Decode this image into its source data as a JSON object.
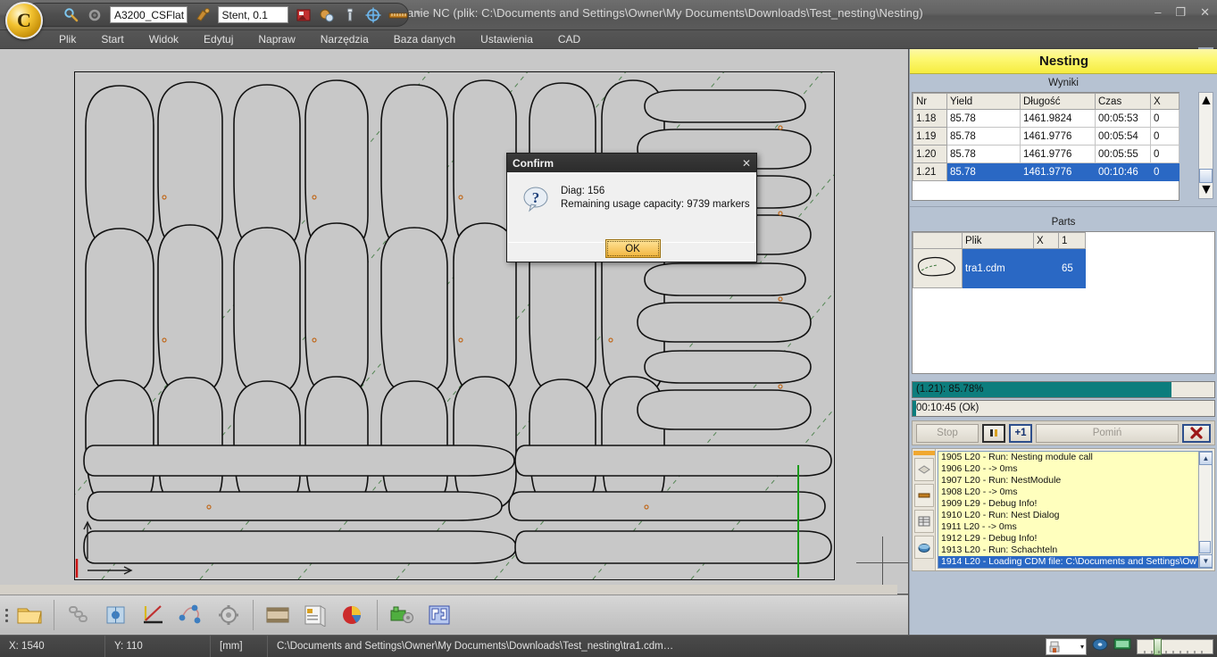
{
  "window": {
    "title": "CAGILA - Programowanie NC (plik: C:\\Documents and Settings\\Owner\\My Documents\\Downloads\\Test_nesting\\Nesting)",
    "minimize": "–",
    "maximize": "❐",
    "close": "✕",
    "orb_letter": "C"
  },
  "toolbar": {
    "icons": [
      "magnifier-icon",
      "gear-small-icon",
      "paint-icon",
      "image-icon",
      "camera-icon",
      "wrench-icon",
      "target-icon",
      "ruler-icon"
    ],
    "field1_value": "A3200_CSFlat",
    "field2_value": "Stent, 0.1",
    "overflow_chevron": "▾"
  },
  "menu": {
    "items": [
      "Plik",
      "Start",
      "Widok",
      "Edytuj",
      "Napraw",
      "Narzędzia",
      "Baza danych",
      "Ustawienia",
      "CAD"
    ]
  },
  "bottom_toolbar": {
    "buttons": [
      {
        "name": "open-folder-icon",
        "glyph": "📁"
      },
      {
        "name": "chain-icon",
        "glyph": "⛓"
      },
      {
        "name": "3d-cube-icon",
        "glyph": "▣"
      },
      {
        "name": "bend-angle-icon",
        "glyph": "∠"
      },
      {
        "name": "nodes-icon",
        "glyph": "⚭"
      },
      {
        "name": "gear-icon",
        "glyph": "⚙"
      },
      {
        "name": "film-icon",
        "glyph": "▤"
      },
      {
        "name": "report-icon",
        "glyph": "▥"
      },
      {
        "name": "pie-chart-icon",
        "glyph": "◕"
      },
      {
        "name": "machine-icon",
        "glyph": "❖"
      },
      {
        "name": "nesting-icon",
        "glyph": "⬚"
      }
    ]
  },
  "canvas": {
    "origin_marker": "origin-axes",
    "crosshair": "crosshair-cursor",
    "scroll_up": "▲",
    "scroll_down": "▼",
    "scroll_left": "◄",
    "scroll_right": "►"
  },
  "nesting_panel": {
    "header": "Nesting",
    "results_label": "Wyniki",
    "results_columns": [
      "Nr",
      "Yield",
      "Długość",
      "Czas",
      "X"
    ],
    "results_rows": [
      {
        "nr": "1.18",
        "yield": "85.78",
        "length": "1461.9824",
        "time": "00:05:53",
        "x": "0",
        "selected": false
      },
      {
        "nr": "1.19",
        "yield": "85.78",
        "length": "1461.9776",
        "time": "00:05:54",
        "x": "0",
        "selected": false
      },
      {
        "nr": "1.20",
        "yield": "85.78",
        "length": "1461.9776",
        "time": "00:05:55",
        "x": "0",
        "selected": false
      },
      {
        "nr": "1.21",
        "yield": "85.78",
        "length": "1461.9776",
        "time": "00:10:46",
        "x": "0",
        "selected": true
      }
    ],
    "parts_label": "Parts",
    "parts_columns": [
      "",
      "Plik",
      "X",
      "1"
    ],
    "parts_rows": [
      {
        "thumb": "part-thumbnail",
        "file": "tra1.cdm",
        "x": "",
        "qty": "65",
        "selected": true
      }
    ],
    "progress_main": {
      "text": "(1.21): 85.78%",
      "percent": 85.78
    },
    "progress_time": {
      "text": "00:10:45 (Ok)",
      "percent": 1
    },
    "controls": {
      "stop_label": "Stop",
      "pause_label": "❙❙",
      "plus_one_label": "+1",
      "skip_label": "Pomiń",
      "cancel_label": "✕"
    },
    "log_lines": [
      {
        "text": "1905 L20 - Run: Nesting module call",
        "selected": false
      },
      {
        "text": "1906 L20 -  -> 0ms",
        "selected": false
      },
      {
        "text": "1907 L20 - Run: NestModule",
        "selected": false
      },
      {
        "text": "1908 L20 -  -> 0ms",
        "selected": false
      },
      {
        "text": "1909 L29 - Debug Info!",
        "selected": false
      },
      {
        "text": "1910 L20 - Run: Nest Dialog",
        "selected": false
      },
      {
        "text": "1911 L20 -  -> 0ms",
        "selected": false
      },
      {
        "text": "1912 L29 - Debug Info!",
        "selected": false
      },
      {
        "text": "1913 L20 - Run: Schachteln",
        "selected": false
      },
      {
        "text": "1914 L20 - Loading CDM file: C:\\Documents and Settings\\Ow",
        "selected": true
      }
    ],
    "log_side_icons": [
      "layers-icon",
      "ruler-icon",
      "table-icon",
      "globe-icon"
    ],
    "scroll_up": "▲",
    "scroll_down": "▼"
  },
  "dialog": {
    "title": "Confirm",
    "close": "✕",
    "icon": "question-mark-icon",
    "line1": "Diag: 156",
    "line2": "Remaining usage capacity:  9739 markers",
    "ok_label": "OK"
  },
  "statusbar": {
    "x": "X: 1540",
    "y": "Y: 110",
    "units": "[mm]",
    "path": "C:\\Documents and Settings\\Owner\\My Documents\\Downloads\\Test_nesting\\tra1.cdm…",
    "combo_glyph": "▾",
    "icons": [
      "printer-icon",
      "disc-icon",
      "monitor-icon",
      "zoom-slider"
    ]
  },
  "colors": {
    "accent_yellow": "#f5ec3f",
    "selection_blue": "#2a68c4",
    "progress_teal": "#0c7d7d",
    "panel_blue_grey": "#b6c2d2",
    "log_yellow": "#ffffbe",
    "sheet_grey": "#c8c8c8"
  }
}
